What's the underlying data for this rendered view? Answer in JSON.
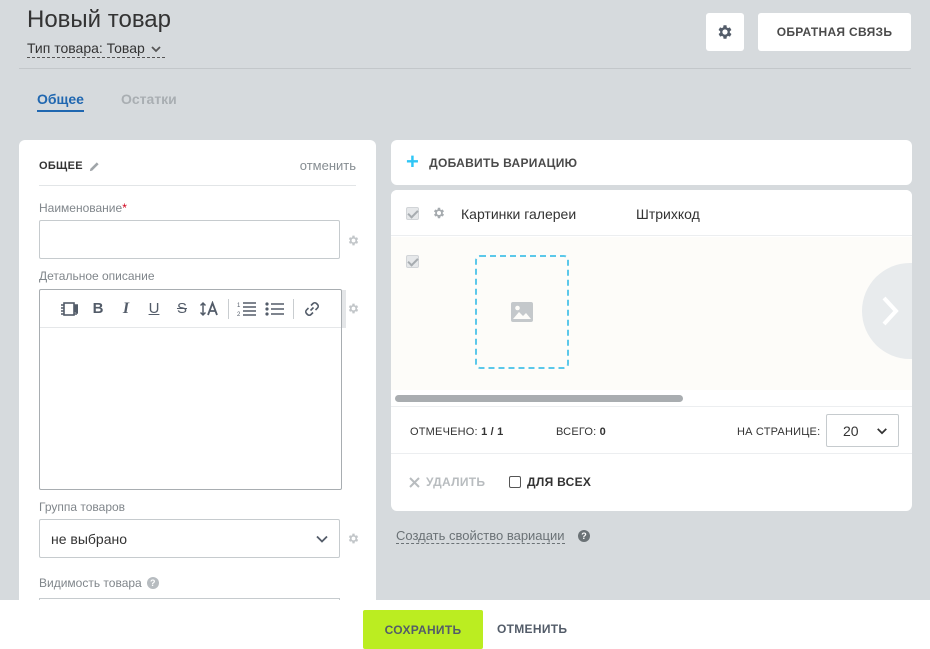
{
  "header": {
    "title": "Новый товар",
    "product_type": "Тип товара: Товар",
    "feedback_label": "ОБРАТНАЯ СВЯЗЬ"
  },
  "tabs": [
    {
      "label": "Общее",
      "active": true
    },
    {
      "label": "Остатки",
      "active": false
    }
  ],
  "general": {
    "section_title": "ОБЩЕЕ",
    "cancel_label": "отменить",
    "name_label": "Наименование",
    "required_mark": "*",
    "description_label": "Детальное описание",
    "group_label": "Группа товаров",
    "group_value": "не выбрано",
    "visibility_label": "Видимость товара"
  },
  "variations": {
    "add_label": "ДОБАВИТЬ ВАРИАЦИЮ",
    "columns": [
      "Картинки галереи",
      "Штрихкод"
    ],
    "selected_label": "ОТМЕЧЕНО:",
    "selected_value": "1 / 1",
    "total_label": "ВСЕГО:",
    "total_value": "0",
    "per_page_label": "НА СТРАНИЦЕ:",
    "per_page_value": "20",
    "delete_label": "УДАЛИТЬ",
    "for_all_label": "ДЛЯ ВСЕХ",
    "create_property_label": "Создать свойство вариации"
  },
  "footer": {
    "save_label": "СОХРАНИТЬ",
    "cancel_label": "ОТМЕНИТЬ"
  },
  "colors": {
    "accent": "#2067b0",
    "save_button": "#bbed21",
    "plus": "#2fc6f6",
    "drop_border": "#5bc8ea"
  },
  "icons": [
    "gear-icon",
    "pencil-icon",
    "chevron-down-icon",
    "image-icon",
    "chevron-right-icon",
    "help-icon",
    "close-icon",
    "plus-icon"
  ]
}
